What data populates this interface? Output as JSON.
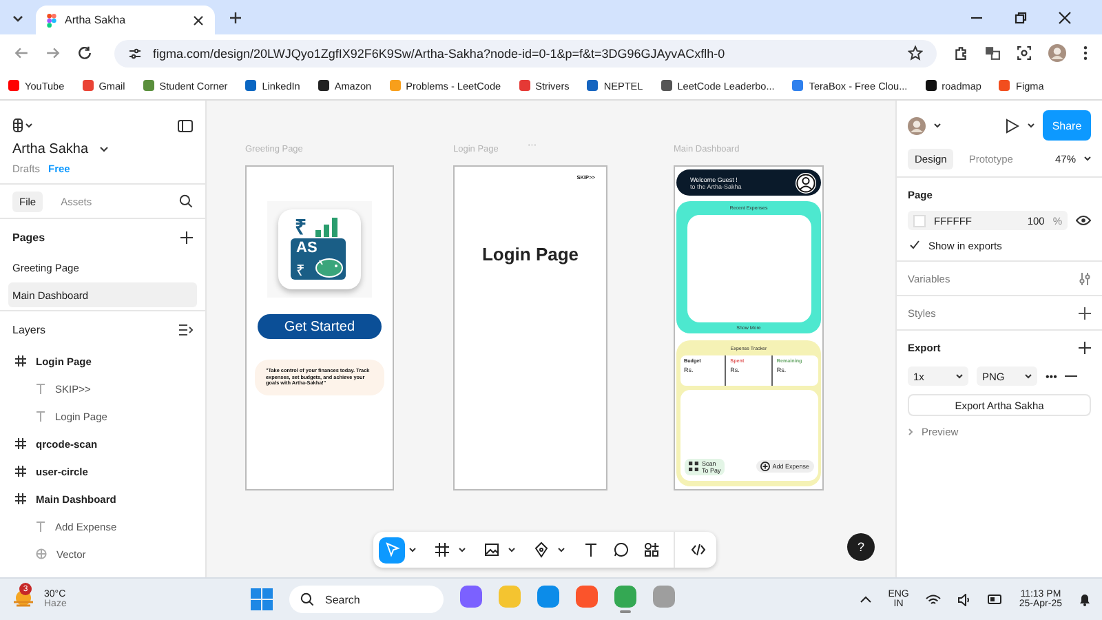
{
  "browser": {
    "tabs": [
      {
        "title": "Artha Sakha",
        "selected": true
      }
    ],
    "url": "figma.com/design/20LWJQyo1ZgfIX92F6K9Sw/Artha-Sakha?node-id=0-1&p=f&t=3DG96GJAyvACxflh-0",
    "bookmarks": [
      {
        "label": "YouTube",
        "color": "#ff0000"
      },
      {
        "label": "Gmail",
        "color": "#ea4335"
      },
      {
        "label": "Student Corner",
        "color": "#5a8f3c"
      },
      {
        "label": "LinkedIn",
        "color": "#0a66c2"
      },
      {
        "label": "Amazon",
        "color": "#222222"
      },
      {
        "label": "Problems - LeetCode",
        "color": "#f89f1b"
      },
      {
        "label": "Strivers",
        "color": "#e53935"
      },
      {
        "label": "NEPTEL",
        "color": "#1565c0"
      },
      {
        "label": "LeetCode Leaderbo...",
        "color": "#555555"
      },
      {
        "label": "TeraBox - Free Clou...",
        "color": "#2f80ed"
      },
      {
        "label": "roadmap",
        "color": "#111111"
      },
      {
        "label": "Figma",
        "color": "#f24e1e"
      }
    ]
  },
  "file": {
    "name": "Artha Sakha",
    "location": "Drafts",
    "plan": "Free"
  },
  "panel_tabs": [
    {
      "label": "File",
      "selected": true
    },
    {
      "label": "Assets",
      "selected": false
    }
  ],
  "pages": {
    "title": "Pages",
    "items": [
      {
        "name": "Greeting Page",
        "selected": false
      },
      {
        "name": "Main Dashboard",
        "selected": true
      }
    ]
  },
  "layers": {
    "title": "Layers",
    "items": [
      {
        "kind": "frame",
        "name": "Login Page",
        "children": [
          {
            "kind": "text",
            "name": "SKIP>>"
          },
          {
            "kind": "text",
            "name": "Login Page"
          }
        ]
      },
      {
        "kind": "frame",
        "name": "qrcode-scan"
      },
      {
        "kind": "frame",
        "name": "user-circle"
      },
      {
        "kind": "frame",
        "name": "Main Dashboard",
        "children": [
          {
            "kind": "text",
            "name": "Add Expense"
          },
          {
            "kind": "vector",
            "name": "Vector"
          }
        ]
      }
    ]
  },
  "frames": [
    {
      "kind": "greeting",
      "label": "Greeting Page",
      "logo": {
        "text": "AS",
        "symbols": [
          "₹",
          "₹"
        ]
      },
      "button": "Get Started",
      "quote": "\"Take control of your finances today. Track expenses, set budgets, and achieve your goals with Artha-Sakha!\""
    },
    {
      "kind": "login",
      "label": "Login Page",
      "menu": "···",
      "skip": "SKIP>>",
      "heading": "Login Page"
    },
    {
      "kind": "dashboard",
      "label": "Main Dashboard",
      "welcome": "Welcome Guest !",
      "subtitle": "to the Artha-Sakha",
      "recent": "Recent Expenses",
      "show_more": "Show More",
      "tracker": "Expense Tracker",
      "columns": [
        {
          "label": "Budget",
          "value": "Rs.",
          "color": "#222222"
        },
        {
          "label": "Spent",
          "value": "Rs.",
          "color": "#e05555"
        },
        {
          "label": "Remaining",
          "value": "Rs.",
          "color": "#6aa86a"
        }
      ],
      "scan": "Scan",
      "scan_sub": "To Pay",
      "add": "Add Expense"
    }
  ],
  "tools": [
    {
      "kind": "move",
      "selected": true,
      "caret": true
    },
    {
      "kind": "frame",
      "selected": false,
      "caret": true
    },
    {
      "kind": "image",
      "selected": false,
      "caret": true
    },
    {
      "kind": "pen",
      "selected": false,
      "caret": true
    },
    {
      "kind": "text",
      "selected": false,
      "caret": false
    },
    {
      "kind": "comment",
      "selected": false,
      "caret": false
    },
    {
      "kind": "actions",
      "selected": false,
      "caret": false
    },
    {
      "kind": "code",
      "selected": false,
      "caret": false
    }
  ],
  "help": "?",
  "inspector": {
    "share": "Share",
    "tabs": [
      {
        "label": "Design",
        "selected": true
      },
      {
        "label": "Prototype",
        "selected": false
      }
    ],
    "zoom": "47%",
    "page_title": "Page",
    "fill": "FFFFFF",
    "opacity": "100",
    "percent": "%",
    "show_in_exports": {
      "label": "Show in exports",
      "checked": true
    },
    "variables": "Variables",
    "styles": "Styles",
    "export_title": "Export",
    "scale": "1x",
    "format": "PNG",
    "more": "•••",
    "export_button": "Export Artha Sakha",
    "preview": "Preview"
  },
  "taskbar": {
    "weather": {
      "temp": "30°C",
      "condition": "Haze",
      "badge": "3"
    },
    "search": "Search",
    "apps": [
      {
        "color": "#7b61ff",
        "selected": false
      },
      {
        "color": "#f4c430",
        "selected": false
      },
      {
        "color": "#0c8ce9",
        "selected": false
      },
      {
        "color": "#fb542b",
        "selected": false
      },
      {
        "color": "#34a853",
        "selected": true
      },
      {
        "color": "#9e9e9e",
        "selected": false
      }
    ],
    "lang": "ENG",
    "region": "IN",
    "time": "11:13 PM",
    "date": "25-Apr-25"
  }
}
